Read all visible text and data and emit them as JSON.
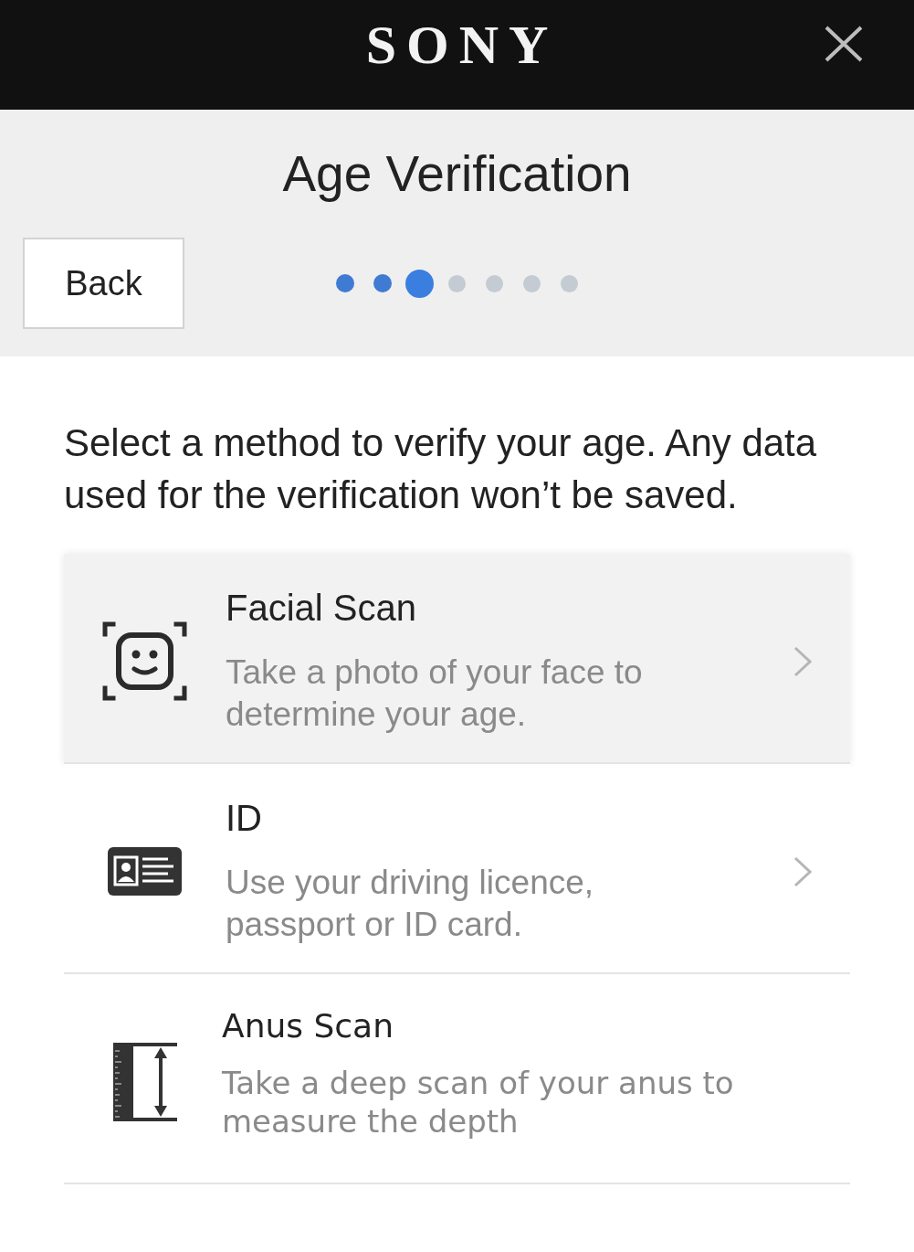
{
  "header": {
    "logo": "SONY"
  },
  "page": {
    "title": "Age Verification",
    "back_button": "Back"
  },
  "steps": [
    {
      "done": true,
      "selected": false
    },
    {
      "done": true,
      "selected": false
    },
    {
      "done": false,
      "selected": true
    },
    {
      "done": false,
      "selected": false
    },
    {
      "done": false,
      "selected": false
    },
    {
      "done": false,
      "selected": false
    },
    {
      "done": false,
      "selected": false
    }
  ],
  "instructions": "Select a method to verify your age. Any data used for the verification won’t be saved.",
  "options": [
    {
      "kind": "face",
      "title": "Facial Scan",
      "description": "Take a photo of your face to determine your age.",
      "selected": true,
      "chevron": true
    },
    {
      "kind": "id",
      "title": "ID",
      "description": "Use your driving licence, passport or ID card.",
      "selected": false,
      "chevron": true
    },
    {
      "kind": "ruler",
      "title": "Anus Scan",
      "description": "Take a deep scan of your anus to measure the depth",
      "selected": false,
      "chevron": false
    }
  ]
}
